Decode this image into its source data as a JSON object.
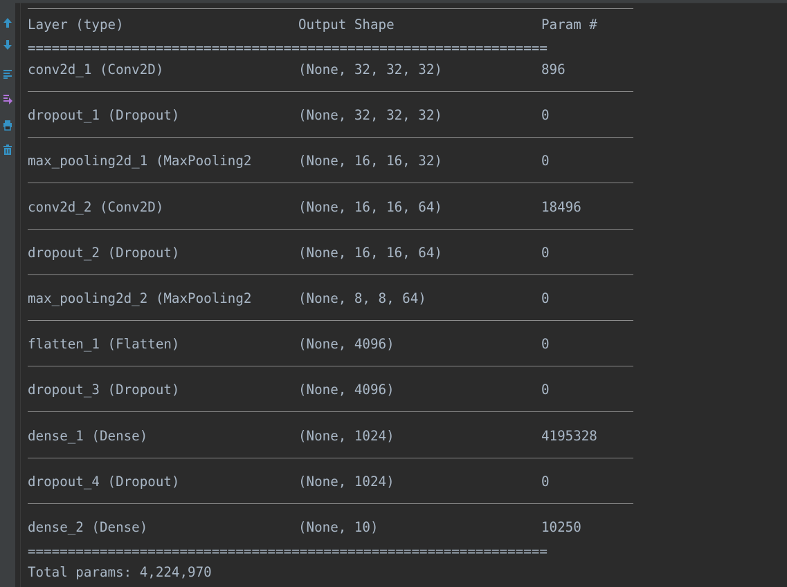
{
  "toolbar": {
    "buttons": [
      {
        "icon": "arrow-up-icon",
        "color": "#3592c4"
      },
      {
        "icon": "arrow-down-icon",
        "color": "#3592c4"
      },
      {
        "icon": "soft-wrap-icon",
        "color": "#3592c4"
      },
      {
        "icon": "scroll-to-end-icon",
        "color": "#b073d9"
      },
      {
        "icon": "print-icon",
        "color": "#3592c4"
      },
      {
        "icon": "trash-icon",
        "color": "#3592c4"
      }
    ]
  },
  "summary": {
    "header": {
      "layer": "Layer (type)",
      "shape": "Output Shape",
      "params": "Param #"
    },
    "double_rule": "=================================================================",
    "rows": [
      {
        "layer": "conv2d_1 (Conv2D)",
        "shape": "(None, 32, 32, 32)",
        "params": "896"
      },
      {
        "layer": "dropout_1 (Dropout)",
        "shape": "(None, 32, 32, 32)",
        "params": "0"
      },
      {
        "layer": "max_pooling2d_1 (MaxPooling2",
        "shape": "(None, 16, 16, 32)",
        "params": "0"
      },
      {
        "layer": "conv2d_2 (Conv2D)",
        "shape": "(None, 16, 16, 64)",
        "params": "18496"
      },
      {
        "layer": "dropout_2 (Dropout)",
        "shape": "(None, 16, 16, 64)",
        "params": "0"
      },
      {
        "layer": "max_pooling2d_2 (MaxPooling2",
        "shape": "(None, 8, 8, 64)",
        "params": "0"
      },
      {
        "layer": "flatten_1 (Flatten)",
        "shape": "(None, 4096)",
        "params": "0"
      },
      {
        "layer": "dropout_3 (Dropout)",
        "shape": "(None, 4096)",
        "params": "0"
      },
      {
        "layer": "dense_1 (Dense)",
        "shape": "(None, 1024)",
        "params": "4195328"
      },
      {
        "layer": "dropout_4 (Dropout)",
        "shape": "(None, 1024)",
        "params": "0"
      },
      {
        "layer": "dense_2 (Dense)",
        "shape": "(None, 10)",
        "params": "10250"
      }
    ],
    "total": "Total params: 4,224,970"
  },
  "colors": {
    "background": "#2b2b2b",
    "gutter": "#3c3f41",
    "text": "#a9b7c6",
    "rule": "#8d8d8d"
  }
}
